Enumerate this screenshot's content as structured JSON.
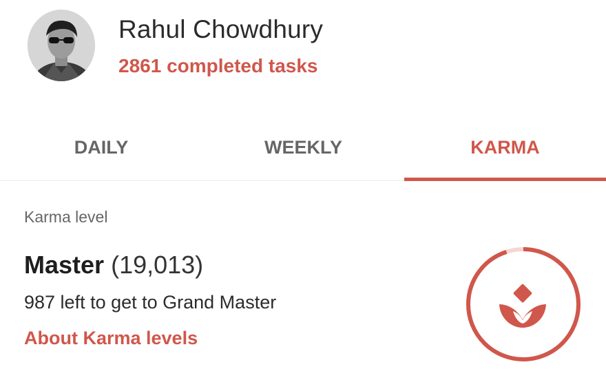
{
  "profile": {
    "name": "Rahul Chowdhury",
    "completed_tasks": "2861 completed tasks"
  },
  "tabs": [
    {
      "label": "DAILY",
      "active": false
    },
    {
      "label": "WEEKLY",
      "active": false
    },
    {
      "label": "KARMA",
      "active": true
    }
  ],
  "karma": {
    "section_label": "Karma level",
    "level_name": "Master",
    "points": "(19,013)",
    "remaining_text": "987 left to get to Grand Master",
    "about_link": "About Karma levels",
    "progress_fraction": 0.95
  },
  "colors": {
    "accent": "#d0574b",
    "tab_inactive": "#666666",
    "text": "#222222"
  },
  "icons": {
    "avatar": "user-avatar-photo",
    "badge": "karma-lotus-icon"
  }
}
